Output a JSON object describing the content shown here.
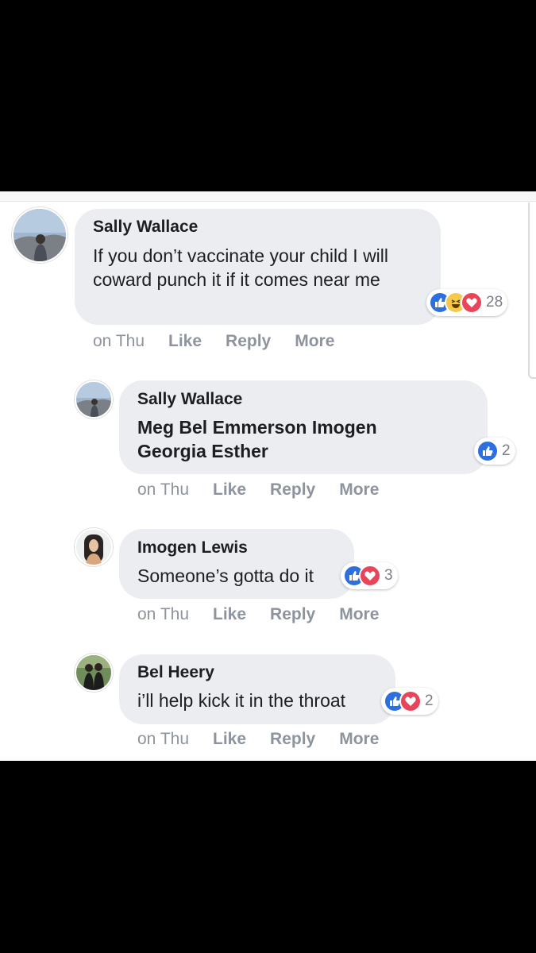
{
  "comments": [
    {
      "author": "Sally Wallace",
      "text": "If you don’t vaccinate your child I will coward punch it if it comes near me",
      "time": "on Thu",
      "actions": [
        "Like",
        "Reply",
        "More"
      ],
      "reaction_count": "28",
      "reactions": [
        "like-icon",
        "haha-icon",
        "love-icon"
      ]
    },
    {
      "author": "Sally Wallace",
      "text": "Meg Bel Emmerson Imogen Georgia Esther",
      "time": "on Thu",
      "actions": [
        "Like",
        "Reply",
        "More"
      ],
      "reaction_count": "2",
      "reactions": [
        "like-icon"
      ]
    },
    {
      "author": "Imogen Lewis",
      "text": "Someone’s gotta do it",
      "time": "on Thu",
      "actions": [
        "Like",
        "Reply",
        "More"
      ],
      "reaction_count": "3",
      "reactions": [
        "like-icon",
        "love-icon"
      ]
    },
    {
      "author": "Bel Heery",
      "text": "i’ll help kick it in the throat",
      "time": "on Thu",
      "actions": [
        "Like",
        "Reply",
        "More"
      ],
      "reaction_count": "2",
      "reactions": [
        "like-icon",
        "love-icon"
      ]
    }
  ],
  "colors": {
    "like": "#2e6fe0",
    "haha": "#f7c94a",
    "love": "#e9455a",
    "bubble": "#ebedf0",
    "meta": "#8d949e"
  }
}
